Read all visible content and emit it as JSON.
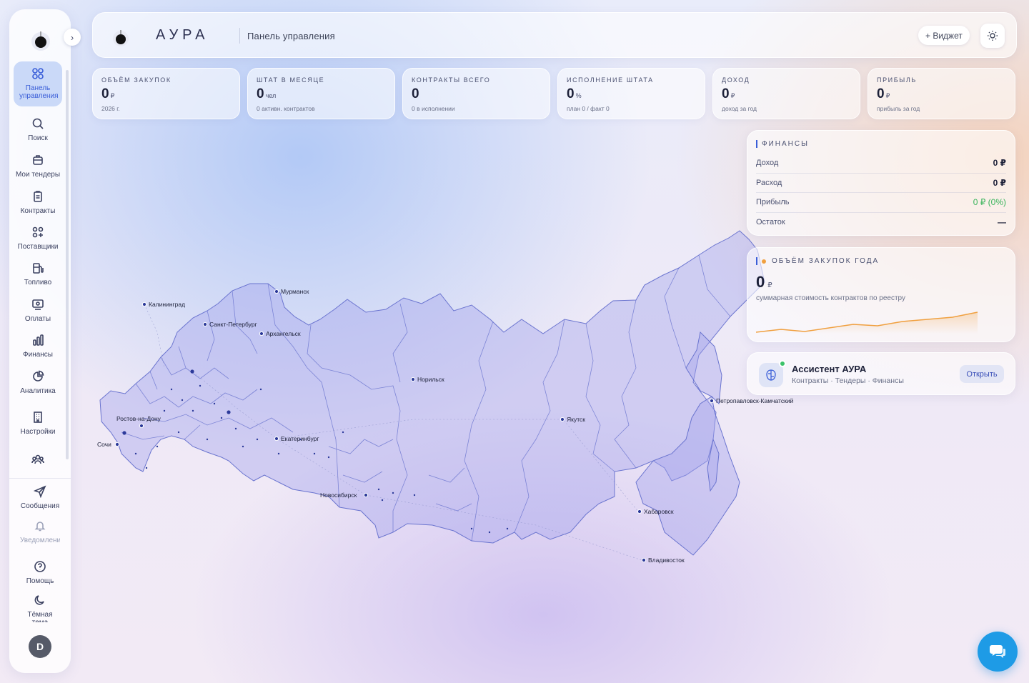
{
  "sidebar": {
    "items": [
      {
        "label": "Панель управления",
        "icon": "dashboard-icon"
      },
      {
        "label": "Поиск",
        "icon": "search-icon"
      },
      {
        "label": "Мои тендеры",
        "icon": "briefcase-icon"
      },
      {
        "label": "Контракты",
        "icon": "clipboard-icon"
      },
      {
        "label": "Поставщики",
        "icon": "suppliers-icon"
      },
      {
        "label": "Топливо",
        "icon": "fuel-icon"
      },
      {
        "label": "Оплаты",
        "icon": "payment-icon"
      },
      {
        "label": "Финансы",
        "icon": "bar-chart-icon"
      },
      {
        "label": "Аналитика",
        "icon": "pie-chart-icon"
      },
      {
        "label": "Настройки",
        "icon": "building-icon"
      }
    ],
    "bottom": [
      {
        "label": "Сообщения",
        "icon": "send-icon"
      },
      {
        "label": "Уведомления",
        "icon": "bell-icon"
      },
      {
        "label": "Помощь",
        "icon": "help-icon"
      },
      {
        "label": "Тёмная тема",
        "icon": "moon-icon"
      }
    ],
    "avatar": "D"
  },
  "header": {
    "brand": "АУРА",
    "title": "Панель управления",
    "widget_label": "+ Виджет"
  },
  "stats": [
    {
      "label": "ОБЪЁМ ЗАКУПОК",
      "value": "0",
      "unit": "₽",
      "sub": "2026 г."
    },
    {
      "label": "ШТАТ В МЕСЯЦЕ",
      "value": "0",
      "unit": "чел",
      "sub": "0 активн. контрактов"
    },
    {
      "label": "КОНТРАКТЫ ВСЕГО",
      "value": "0",
      "unit": "",
      "sub": "0 в исполнении"
    },
    {
      "label": "ИСПОЛНЕНИЕ ШТАТА",
      "value": "0",
      "unit": "%",
      "sub": "план 0 / факт 0"
    },
    {
      "label": "ДОХОД",
      "value": "0",
      "unit": "₽",
      "sub": "доход за год"
    },
    {
      "label": "ПРИБЫЛЬ",
      "value": "0",
      "unit": "₽",
      "sub": "прибыль за год"
    }
  ],
  "finance": {
    "title": "ФИНАНСЫ",
    "rows": [
      {
        "label": "Доход",
        "value": "0 ₽"
      },
      {
        "label": "Расход",
        "value": "0 ₽"
      },
      {
        "label": "Прибыль",
        "value": "0 ₽ (0%)"
      },
      {
        "label": "Остаток",
        "value": "—"
      }
    ],
    "accent": "#3a5ed8",
    "profit_color": "#37b35a"
  },
  "volume": {
    "title": "ОБЪЁМ ЗАКУПОК ГОДА",
    "value": "0",
    "unit": "₽",
    "sub": "суммарная стоимость контрактов по реестру",
    "spark_color": "#f0a040"
  },
  "assistant": {
    "title": "Ассистент АУРА",
    "sub": "Контракты · Тендеры · Финансы",
    "button": "Открыть"
  },
  "map": {
    "cities": [
      "Калининград",
      "Мурманск",
      "Санкт-Петербург",
      "Архангельск",
      "Ростов-на-Дону",
      "Сочи",
      "Екатеринбург",
      "Новосибирск",
      "Норильск",
      "Якутск",
      "Петропавловск-Камчатский",
      "Хабаровск",
      "Владивосток"
    ]
  }
}
